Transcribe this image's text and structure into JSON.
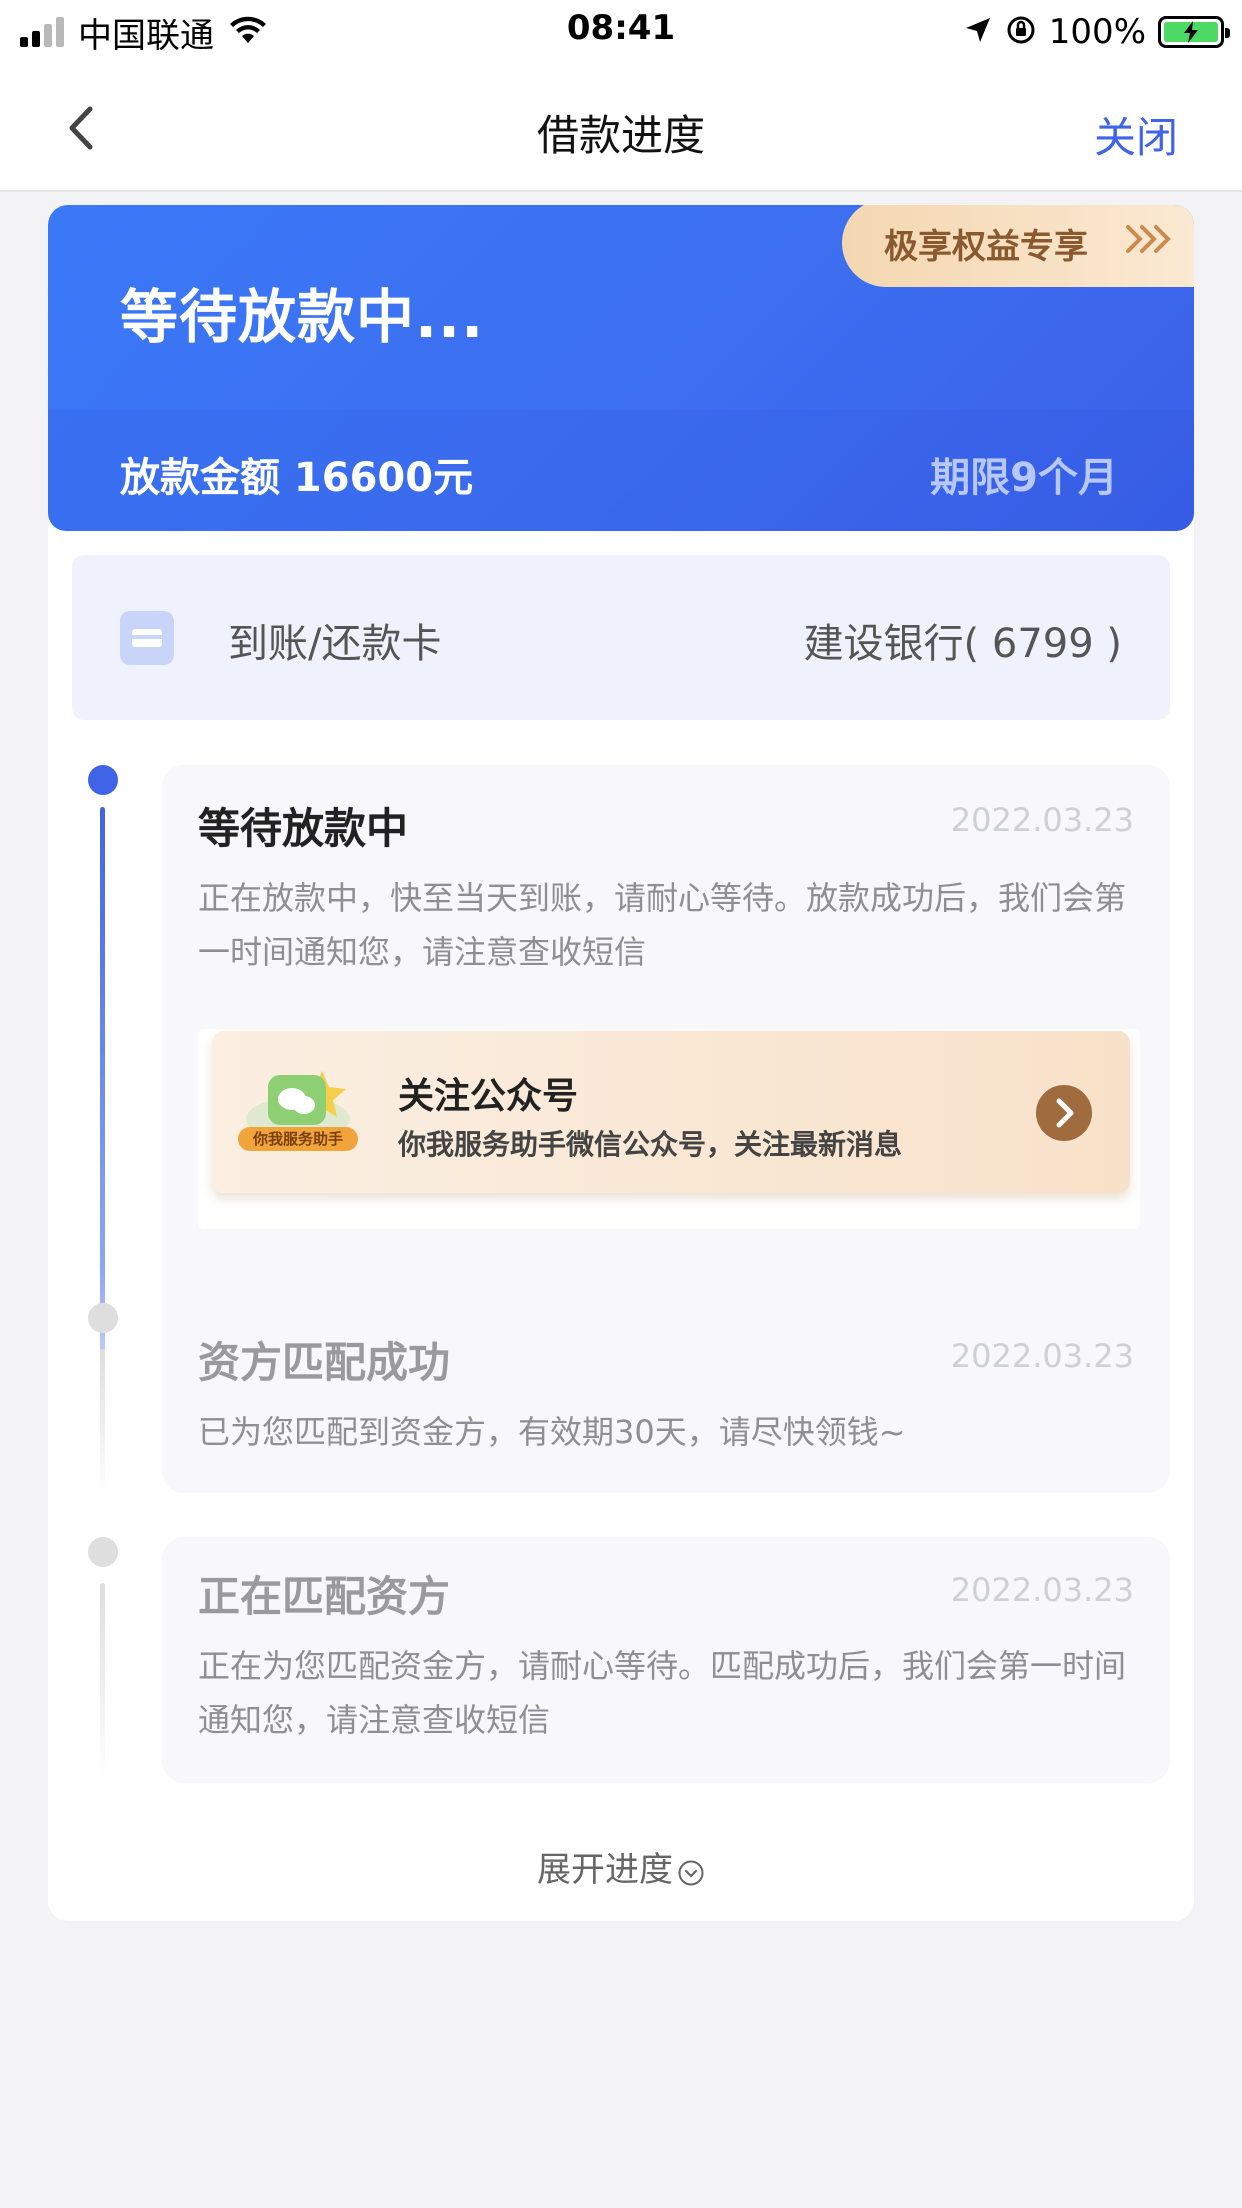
{
  "status_bar": {
    "carrier": "中国联通",
    "time": "08:41",
    "battery": "100%"
  },
  "nav": {
    "title": "借款进度",
    "close_label": "关闭"
  },
  "hero": {
    "title": "等待放款中...",
    "amount": "放款金额 16600元",
    "term": "期限9个月",
    "perk_badge": "极享权益专享"
  },
  "bank": {
    "label": "到账/还款卡",
    "value": "建设银行( 6799 )"
  },
  "steps": [
    {
      "title": "等待放款中",
      "date": "2022.03.23",
      "desc": "正在放款中，快至当天到账，请耐心等待。放款成功后，我们会第一时间通知您，请注意查收短信",
      "active": true
    },
    {
      "title": "资方匹配成功",
      "date": "2022.03.23",
      "desc": "已为您匹配到资金方，有效期30天，请尽快领钱~",
      "active": false
    },
    {
      "title": "正在匹配资方",
      "date": "2022.03.23",
      "desc": "正在为您匹配资金方，请耐心等待。匹配成功后，我们会第一时间通知您，请注意查收短信",
      "active": false
    }
  ],
  "promo": {
    "logo_text": "你我服务助手",
    "title": "关注公众号",
    "subtitle": "你我服务助手微信公众号，关注最新消息"
  },
  "expand_label": "展开进度",
  "colors": {
    "accent": "#3f64e8",
    "hero_blue": "#3b6cf1",
    "active_dot": "#3f64e8",
    "inactive_dot": "#dedede"
  },
  "icons": [
    "signal-icon",
    "wifi-icon",
    "location-icon",
    "orientation-lock-icon",
    "battery-icon",
    "back-icon",
    "credit-card-icon",
    "chevron-right-icon",
    "wechat-icon",
    "chevron-down-circle-icon"
  ]
}
